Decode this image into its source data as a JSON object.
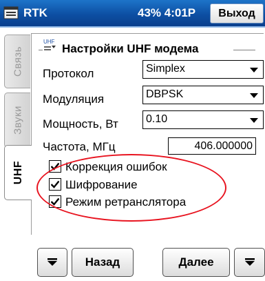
{
  "titlebar": {
    "app_title": "RTK",
    "status": "43% 4:01P",
    "exit_label": "Выход",
    "start_icon": "windows-start-icon"
  },
  "tabs": [
    {
      "label": "Связь",
      "active": false
    },
    {
      "label": "Звуки",
      "active": false
    },
    {
      "label": "UHF",
      "active": true
    }
  ],
  "section": {
    "title": "Настройки UHF модема",
    "icon": "uhf-icon",
    "icon_text": "UHF"
  },
  "fields": {
    "protocol_label": "Протокол",
    "protocol_value": "Simplex",
    "modulation_label": "Модуляция",
    "modulation_value": "DBPSK",
    "power_label": "Мощность, Вт",
    "power_value": "0.10",
    "frequency_label": "Частота, МГц",
    "frequency_value": "406.000000"
  },
  "checkboxes": [
    {
      "label": "Коррекция ошибок",
      "checked": true
    },
    {
      "label": "Шифрование",
      "checked": true
    },
    {
      "label": "Режим ретранслятора",
      "checked": true
    }
  ],
  "annotation": {
    "color": "#e8131f"
  },
  "toolbar": {
    "back_label": "Назад",
    "next_label": "Далее",
    "menu_left_icon": "triangle-down-icon",
    "menu_right_icon": "triangle-down-icon"
  },
  "colors": {
    "titlebar": "#0d4fa3",
    "titlebar_text": "#ffffff"
  }
}
